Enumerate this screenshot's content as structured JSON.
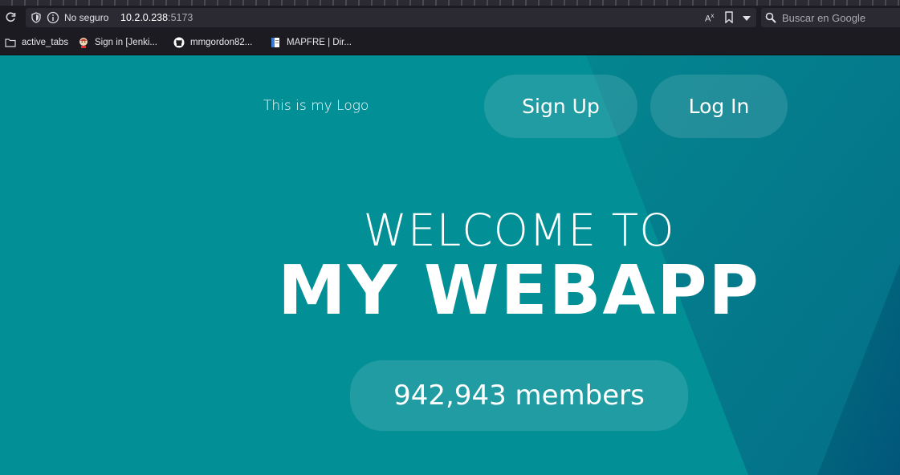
{
  "browser": {
    "security_label": "No seguro",
    "url_host": "10.2.0.238",
    "url_port": ":5173",
    "search_placeholder": "Buscar en Google",
    "bookmarks": [
      {
        "label": "active_tabs",
        "icon": "folder-icon"
      },
      {
        "label": "Sign in [Jenki...",
        "icon": "jenkins-icon"
      },
      {
        "label": "mmgordon82...",
        "icon": "github-icon"
      },
      {
        "label": "MAPFRE | Dir...",
        "icon": "document-icon"
      }
    ]
  },
  "page": {
    "logo_text": "This is my Logo",
    "signup_label": "Sign Up",
    "login_label": "Log In",
    "welcome_line": "WELCOME TO",
    "app_title": "MY WEBAPP",
    "members_text": "942,943 members"
  },
  "colors": {
    "page_background": "#038f96",
    "accent_dark": "#01607f",
    "pill_background": "rgba(255,255,255,0.12)"
  }
}
